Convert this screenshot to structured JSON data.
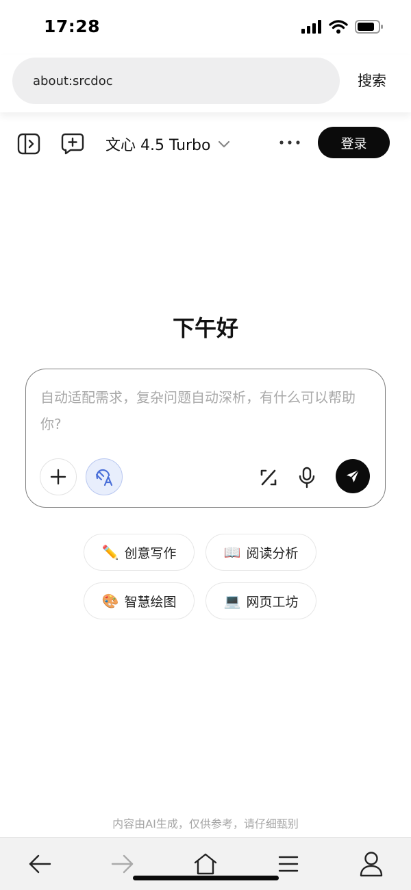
{
  "status_bar": {
    "time": "17:28",
    "icons": [
      "cellular-signal-icon",
      "wifi-icon",
      "battery-icon"
    ]
  },
  "browser": {
    "url": "about:srcdoc",
    "search_label": "搜索"
  },
  "app_header": {
    "icons": [
      "sidebar-toggle-icon",
      "new-chat-icon",
      "chevron-down-icon",
      "more-icon"
    ],
    "model_name": "文心 4.5 Turbo",
    "login_label": "登录"
  },
  "main": {
    "greeting": "下午好",
    "composer": {
      "placeholder": "自动适配需求，复杂问题自动深析，有什么可以帮助你?",
      "icons": [
        "plus-icon",
        "ai-translate-icon",
        "percent-tool-icon",
        "microphone-icon",
        "send-icon"
      ]
    },
    "quick_actions": [
      {
        "emoji": "✏️",
        "label": "创意写作"
      },
      {
        "emoji": "📖",
        "label": "阅读分析"
      },
      {
        "emoji": "🎨",
        "label": "智慧绘图"
      },
      {
        "emoji": "💻",
        "label": "网页工坊"
      }
    ],
    "disclaimer": "内容由AI生成，仅供参考，请仔细甄别"
  },
  "bottom_nav": {
    "icons": [
      "back-arrow-icon",
      "forward-arrow-icon",
      "home-icon",
      "menu-icon",
      "profile-icon"
    ]
  },
  "colors": {
    "accent_dark": "#0b0b0b",
    "ai_button_bg": "#e8eefc",
    "ai_icon": "#4a6fd8",
    "placeholder": "#a9a9a9"
  }
}
